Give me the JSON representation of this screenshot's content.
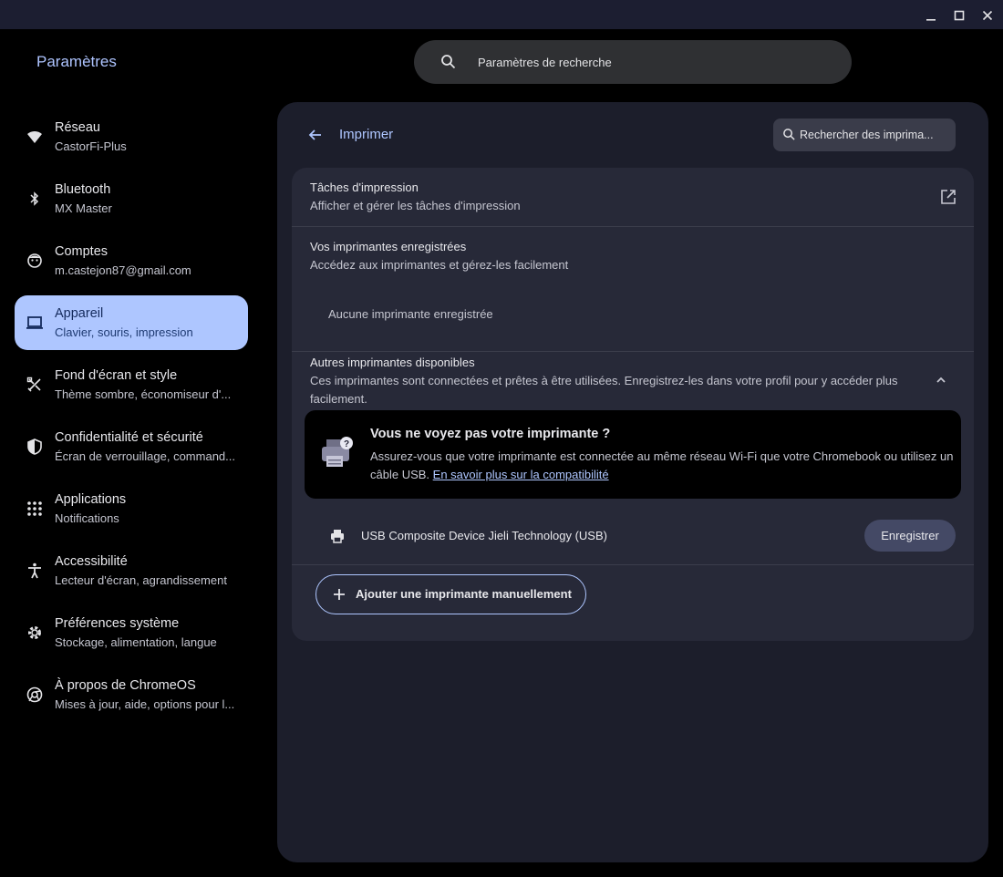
{
  "window": {
    "controls": [
      "minimize",
      "maximize",
      "close"
    ]
  },
  "app": {
    "title": "Paramètres"
  },
  "search": {
    "placeholder": "Paramètres de recherche"
  },
  "sidebar": {
    "items": [
      {
        "label": "Réseau",
        "sub": "CastorFi-Plus",
        "icon": "wifi-icon",
        "active": false
      },
      {
        "label": "Bluetooth",
        "sub": "MX Master",
        "icon": "bluetooth-icon",
        "active": false
      },
      {
        "label": "Comptes",
        "sub": "m.castejon87@gmail.com",
        "icon": "account-icon",
        "active": false
      },
      {
        "label": "Appareil",
        "sub": "Clavier, souris, impression",
        "icon": "laptop-icon",
        "active": true
      },
      {
        "label": "Fond d'écran et style",
        "sub": "Thème sombre, économiseur d'...",
        "icon": "palette-icon",
        "active": false
      },
      {
        "label": "Confidentialité et sécurité",
        "sub": "Écran de verrouillage, command...",
        "icon": "shield-icon",
        "active": false
      },
      {
        "label": "Applications",
        "sub": "Notifications",
        "icon": "apps-grid-icon",
        "active": false
      },
      {
        "label": "Accessibilité",
        "sub": "Lecteur d'écran, agrandissement",
        "icon": "accessibility-icon",
        "active": false
      },
      {
        "label": "Préférences système",
        "sub": "Stockage, alimentation, langue",
        "icon": "gear-icon",
        "active": false
      },
      {
        "label": "À propos de ChromeOS",
        "sub": "Mises à jour, aide, options pour l...",
        "icon": "chrome-icon",
        "active": false
      }
    ]
  },
  "page": {
    "title": "Imprimer",
    "search_placeholder": "Rechercher des imprima..."
  },
  "print_jobs": {
    "title": "Tâches d'impression",
    "sub": "Afficher et gérer les tâches d'impression"
  },
  "saved_printers": {
    "title": "Vos imprimantes enregistrées",
    "sub": "Accédez aux imprimantes et gérez-les facilement",
    "empty": "Aucune imprimante enregistrée"
  },
  "other_printers": {
    "title": "Autres imprimantes disponibles",
    "sub_line1": "Ces imprimantes sont connectées et prêtes à être utilisées. Enregistrez-les dans votre profil pour y accéder plus",
    "sub_line2": "facilement."
  },
  "callout": {
    "title": "Vous ne voyez pas votre imprimante ?",
    "body": "Assurez-vous que votre imprimante est connectée au même réseau Wi-Fi que votre Chromebook ou utilisez un câble USB.",
    "link": "En savoir plus sur la compatibilité"
  },
  "printer": {
    "name": "USB Composite Device Jieli Technology (USB)",
    "register_label": "Enregistrer"
  },
  "add_printer": {
    "label": "Ajouter une imprimante manuellement"
  }
}
